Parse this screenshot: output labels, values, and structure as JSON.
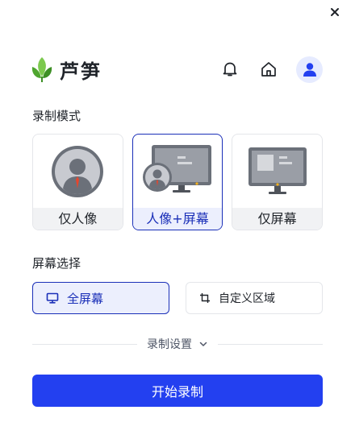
{
  "app": {
    "name": "芦笋",
    "close_icon": "close-icon"
  },
  "header": {
    "logo_icon": "leaf-logo-icon",
    "notification_icon": "bell-icon",
    "home_icon": "home-icon",
    "avatar_icon": "user-avatar-icon"
  },
  "record_mode": {
    "title": "录制模式",
    "selected": "人像+屏幕",
    "options": [
      {
        "label": "仅人像",
        "icon": "portrait-only-icon"
      },
      {
        "label": "人像+屏幕",
        "icon": "portrait-screen-icon"
      },
      {
        "label": "仅屏幕",
        "icon": "screen-only-icon"
      }
    ]
  },
  "screen_select": {
    "title": "屏幕选择",
    "selected": "全屏幕",
    "options": [
      {
        "label": "全屏幕",
        "icon": "monitor-icon"
      },
      {
        "label": "自定义区域",
        "icon": "crop-icon"
      }
    ]
  },
  "settings": {
    "label": "录制设置",
    "icon": "chevron-down-icon"
  },
  "start_button": {
    "label": "开始录制"
  },
  "colors": {
    "accent": "#2340f0",
    "selected_border": "#1a2fb8",
    "selected_bg": "#eceffd",
    "leaf_green": "#5bb53a"
  }
}
